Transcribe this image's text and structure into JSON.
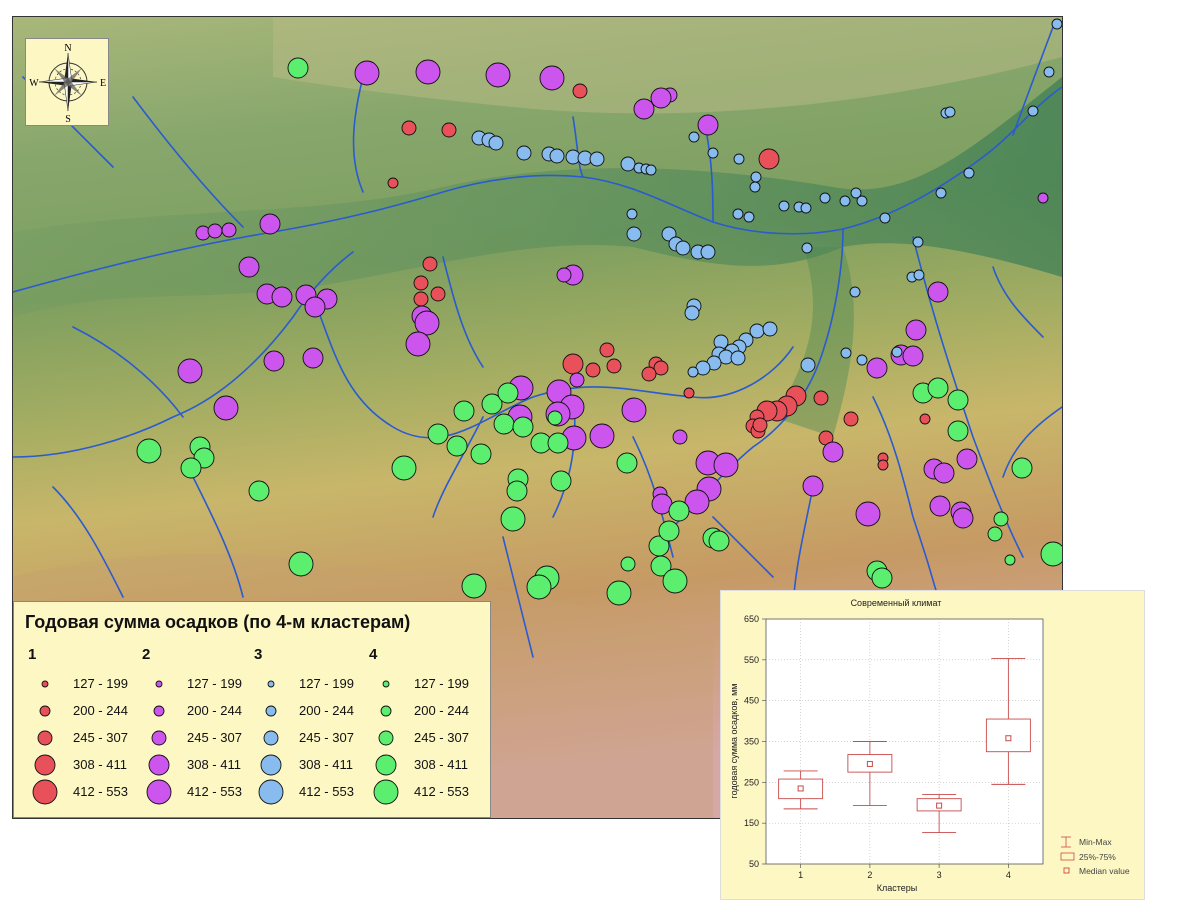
{
  "compass": {
    "n": "N",
    "s": "S",
    "e": "E",
    "w": "W"
  },
  "legend": {
    "title": "Годовая сумма осадков (по 4-м кластерам)",
    "clusters": [
      {
        "label": "1",
        "color": "#e8505a"
      },
      {
        "label": "2",
        "color": "#cc55ee"
      },
      {
        "label": "3",
        "color": "#88bbee"
      },
      {
        "label": "4",
        "color": "#5cee6e"
      }
    ],
    "classes": [
      "127 - 199",
      "200 - 244",
      "245 - 307",
      "308 - 411",
      "412 - 553"
    ]
  },
  "chart_data": {
    "type": "boxplot",
    "title": "Современный климат",
    "xlabel": "Кластеры",
    "ylabel": "годовая сумма осадков, мм",
    "categories": [
      "1",
      "2",
      "3",
      "4"
    ],
    "ylim": [
      50,
      650
    ],
    "yticks": [
      50,
      150,
      250,
      350,
      450,
      550,
      650
    ],
    "min": [
      185,
      193,
      127,
      245
    ],
    "q1": [
      210,
      275,
      180,
      325
    ],
    "median": [
      235,
      295,
      193,
      358
    ],
    "q3": [
      258,
      318,
      210,
      405
    ],
    "max": [
      278,
      350,
      220,
      553
    ],
    "legend": [
      "Min-Max",
      "25%-75%",
      "Median value"
    ],
    "color": "#c84a4a"
  },
  "stations": {
    "cluster1": [
      [
        579,
        90,
        2
      ],
      [
        408,
        127,
        2
      ],
      [
        448,
        129,
        2
      ],
      [
        768,
        158,
        3
      ],
      [
        392,
        182,
        1
      ],
      [
        429,
        263,
        2
      ],
      [
        420,
        282,
        2
      ],
      [
        437,
        293,
        2
      ],
      [
        420,
        298,
        2
      ],
      [
        572,
        363,
        3
      ],
      [
        592,
        369,
        2
      ],
      [
        606,
        349,
        2
      ],
      [
        613,
        365,
        2
      ],
      [
        655,
        363,
        2
      ],
      [
        660,
        367,
        2
      ],
      [
        648,
        373,
        2
      ],
      [
        688,
        392,
        1
      ],
      [
        795,
        395,
        3
      ],
      [
        786,
        405,
        3
      ],
      [
        776,
        410,
        3
      ],
      [
        766,
        410,
        3
      ],
      [
        756,
        416,
        2
      ],
      [
        752,
        425,
        2
      ],
      [
        757,
        430,
        2
      ],
      [
        759,
        424,
        2
      ],
      [
        820,
        397,
        2
      ],
      [
        850,
        418,
        2
      ],
      [
        825,
        437,
        2
      ],
      [
        882,
        457,
        1
      ],
      [
        882,
        464,
        1
      ],
      [
        924,
        418,
        1
      ]
    ],
    "cluster2": [
      [
        366,
        72,
        4
      ],
      [
        427,
        71,
        4
      ],
      [
        497,
        74,
        4
      ],
      [
        551,
        77,
        4
      ],
      [
        669,
        94,
        2
      ],
      [
        660,
        97,
        3
      ],
      [
        643,
        108,
        3
      ],
      [
        707,
        124,
        3
      ],
      [
        1042,
        197,
        1
      ],
      [
        202,
        232,
        2
      ],
      [
        214,
        230,
        2
      ],
      [
        228,
        229,
        2
      ],
      [
        269,
        223,
        3
      ],
      [
        248,
        266,
        3
      ],
      [
        266,
        293,
        3
      ],
      [
        281,
        296,
        3
      ],
      [
        305,
        294,
        3
      ],
      [
        326,
        298,
        3
      ],
      [
        314,
        306,
        3
      ],
      [
        572,
        274,
        3
      ],
      [
        563,
        274,
        2
      ],
      [
        421,
        315,
        3
      ],
      [
        426,
        322,
        4
      ],
      [
        937,
        291,
        3
      ],
      [
        915,
        329,
        3
      ],
      [
        417,
        343,
        4
      ],
      [
        273,
        360,
        3
      ],
      [
        312,
        357,
        3
      ],
      [
        189,
        370,
        4
      ],
      [
        900,
        354,
        3
      ],
      [
        912,
        355,
        3
      ],
      [
        876,
        367,
        3
      ],
      [
        576,
        379,
        2
      ],
      [
        520,
        387,
        4
      ],
      [
        558,
        391,
        4
      ],
      [
        571,
        406,
        4
      ],
      [
        519,
        416,
        4
      ],
      [
        557,
        413,
        4
      ],
      [
        633,
        409,
        4
      ],
      [
        573,
        437,
        4
      ],
      [
        601,
        435,
        4
      ],
      [
        679,
        436,
        2
      ],
      [
        225,
        407,
        4
      ],
      [
        707,
        462,
        4
      ],
      [
        725,
        464,
        4
      ],
      [
        708,
        488,
        4
      ],
      [
        659,
        493,
        2
      ],
      [
        661,
        503,
        3
      ],
      [
        696,
        501,
        4
      ],
      [
        812,
        485,
        3
      ],
      [
        832,
        451,
        3
      ],
      [
        933,
        468,
        3
      ],
      [
        943,
        472,
        3
      ],
      [
        966,
        458,
        3
      ],
      [
        939,
        505,
        3
      ],
      [
        960,
        511,
        3
      ],
      [
        962,
        517,
        3
      ],
      [
        867,
        513,
        4
      ]
    ],
    "cluster3": [
      [
        478,
        137,
        2
      ],
      [
        488,
        139,
        2
      ],
      [
        495,
        142,
        2
      ],
      [
        523,
        152,
        2
      ],
      [
        548,
        153,
        2
      ],
      [
        556,
        155,
        2
      ],
      [
        572,
        156,
        2
      ],
      [
        584,
        157,
        2
      ],
      [
        596,
        158,
        2
      ],
      [
        627,
        163,
        2
      ],
      [
        638,
        167,
        1
      ],
      [
        645,
        168,
        1
      ],
      [
        650,
        169,
        1
      ],
      [
        693,
        136,
        1
      ],
      [
        712,
        152,
        1
      ],
      [
        738,
        158,
        1
      ],
      [
        755,
        176,
        1
      ],
      [
        754,
        186,
        1
      ],
      [
        631,
        213,
        1
      ],
      [
        633,
        233,
        2
      ],
      [
        668,
        233,
        2
      ],
      [
        675,
        243,
        2
      ],
      [
        682,
        247,
        2
      ],
      [
        697,
        251,
        2
      ],
      [
        707,
        251,
        2
      ],
      [
        737,
        213,
        1
      ],
      [
        748,
        216,
        1
      ],
      [
        783,
        205,
        1
      ],
      [
        798,
        206,
        1
      ],
      [
        805,
        207,
        1
      ],
      [
        824,
        197,
        1
      ],
      [
        844,
        200,
        1
      ],
      [
        855,
        192,
        1
      ],
      [
        861,
        200,
        1
      ],
      [
        940,
        192,
        1
      ],
      [
        968,
        172,
        1
      ],
      [
        884,
        217,
        1
      ],
      [
        806,
        247,
        1
      ],
      [
        917,
        241,
        1
      ],
      [
        911,
        276,
        1
      ],
      [
        918,
        274,
        1
      ],
      [
        854,
        291,
        1
      ],
      [
        1056,
        23,
        1
      ],
      [
        1048,
        71,
        1
      ],
      [
        945,
        112,
        1
      ],
      [
        949,
        111,
        1
      ],
      [
        1032,
        110,
        1
      ],
      [
        693,
        305,
        2
      ],
      [
        691,
        312,
        2
      ],
      [
        756,
        330,
        2
      ],
      [
        769,
        328,
        2
      ],
      [
        745,
        339,
        2
      ],
      [
        738,
        346,
        2
      ],
      [
        720,
        341,
        2
      ],
      [
        731,
        350,
        2
      ],
      [
        718,
        353,
        2
      ],
      [
        725,
        356,
        2
      ],
      [
        713,
        362,
        2
      ],
      [
        702,
        367,
        2
      ],
      [
        737,
        357,
        2
      ],
      [
        807,
        364,
        2
      ],
      [
        845,
        352,
        1
      ],
      [
        896,
        351,
        1
      ],
      [
        861,
        359,
        1
      ],
      [
        692,
        371,
        1
      ]
    ],
    "cluster4": [
      [
        297,
        67,
        3
      ],
      [
        148,
        450,
        4
      ],
      [
        199,
        446,
        3
      ],
      [
        203,
        457,
        3
      ],
      [
        190,
        467,
        3
      ],
      [
        258,
        490,
        3
      ],
      [
        403,
        467,
        4
      ],
      [
        437,
        433,
        3
      ],
      [
        463,
        410,
        3
      ],
      [
        491,
        403,
        3
      ],
      [
        507,
        392,
        3
      ],
      [
        456,
        445,
        3
      ],
      [
        480,
        453,
        3
      ],
      [
        503,
        423,
        3
      ],
      [
        522,
        426,
        3
      ],
      [
        540,
        442,
        3
      ],
      [
        557,
        442,
        3
      ],
      [
        554,
        417,
        2
      ],
      [
        517,
        478,
        3
      ],
      [
        516,
        490,
        3
      ],
      [
        560,
        480,
        3
      ],
      [
        512,
        518,
        4
      ],
      [
        300,
        563,
        4
      ],
      [
        473,
        585,
        4
      ],
      [
        546,
        577,
        4
      ],
      [
        538,
        586,
        4
      ],
      [
        618,
        592,
        4
      ],
      [
        626,
        462,
        3
      ],
      [
        627,
        563,
        2
      ],
      [
        660,
        565,
        3
      ],
      [
        658,
        545,
        3
      ],
      [
        668,
        530,
        3
      ],
      [
        678,
        510,
        3
      ],
      [
        674,
        580,
        4
      ],
      [
        712,
        537,
        3
      ],
      [
        718,
        540,
        3
      ],
      [
        922,
        392,
        3
      ],
      [
        937,
        387,
        3
      ],
      [
        957,
        399,
        3
      ],
      [
        957,
        430,
        3
      ],
      [
        1021,
        467,
        3
      ],
      [
        1000,
        518,
        2
      ],
      [
        994,
        533,
        2
      ],
      [
        1009,
        559,
        1
      ],
      [
        1052,
        553,
        4
      ],
      [
        876,
        570,
        3
      ],
      [
        881,
        577,
        3
      ]
    ]
  }
}
